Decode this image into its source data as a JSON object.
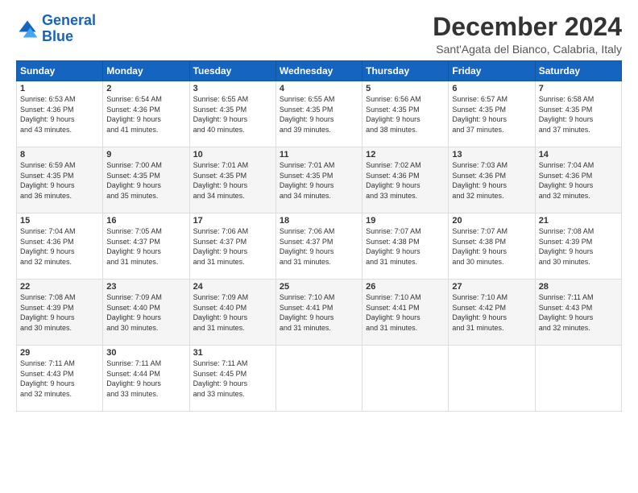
{
  "logo": {
    "line1": "General",
    "line2": "Blue"
  },
  "title": "December 2024",
  "subtitle": "Sant'Agata del Bianco, Calabria, Italy",
  "days": [
    "Sunday",
    "Monday",
    "Tuesday",
    "Wednesday",
    "Thursday",
    "Friday",
    "Saturday"
  ],
  "weeks": [
    [
      {
        "day": "1",
        "sunrise": "6:53 AM",
        "sunset": "4:36 PM",
        "daylight_hours": "9 hours",
        "daylight_min": "43 minutes."
      },
      {
        "day": "2",
        "sunrise": "6:54 AM",
        "sunset": "4:36 PM",
        "daylight_hours": "9 hours",
        "daylight_min": "41 minutes."
      },
      {
        "day": "3",
        "sunrise": "6:55 AM",
        "sunset": "4:35 PM",
        "daylight_hours": "9 hours",
        "daylight_min": "40 minutes."
      },
      {
        "day": "4",
        "sunrise": "6:55 AM",
        "sunset": "4:35 PM",
        "daylight_hours": "9 hours",
        "daylight_min": "39 minutes."
      },
      {
        "day": "5",
        "sunrise": "6:56 AM",
        "sunset": "4:35 PM",
        "daylight_hours": "9 hours",
        "daylight_min": "38 minutes."
      },
      {
        "day": "6",
        "sunrise": "6:57 AM",
        "sunset": "4:35 PM",
        "daylight_hours": "9 hours",
        "daylight_min": "37 minutes."
      },
      {
        "day": "7",
        "sunrise": "6:58 AM",
        "sunset": "4:35 PM",
        "daylight_hours": "9 hours",
        "daylight_min": "37 minutes."
      }
    ],
    [
      {
        "day": "8",
        "sunrise": "6:59 AM",
        "sunset": "4:35 PM",
        "daylight_hours": "9 hours",
        "daylight_min": "36 minutes."
      },
      {
        "day": "9",
        "sunrise": "7:00 AM",
        "sunset": "4:35 PM",
        "daylight_hours": "9 hours",
        "daylight_min": "35 minutes."
      },
      {
        "day": "10",
        "sunrise": "7:01 AM",
        "sunset": "4:35 PM",
        "daylight_hours": "9 hours",
        "daylight_min": "34 minutes."
      },
      {
        "day": "11",
        "sunrise": "7:01 AM",
        "sunset": "4:35 PM",
        "daylight_hours": "9 hours",
        "daylight_min": "34 minutes."
      },
      {
        "day": "12",
        "sunrise": "7:02 AM",
        "sunset": "4:36 PM",
        "daylight_hours": "9 hours",
        "daylight_min": "33 minutes."
      },
      {
        "day": "13",
        "sunrise": "7:03 AM",
        "sunset": "4:36 PM",
        "daylight_hours": "9 hours",
        "daylight_min": "32 minutes."
      },
      {
        "day": "14",
        "sunrise": "7:04 AM",
        "sunset": "4:36 PM",
        "daylight_hours": "9 hours",
        "daylight_min": "32 minutes."
      }
    ],
    [
      {
        "day": "15",
        "sunrise": "7:04 AM",
        "sunset": "4:36 PM",
        "daylight_hours": "9 hours",
        "daylight_min": "32 minutes."
      },
      {
        "day": "16",
        "sunrise": "7:05 AM",
        "sunset": "4:37 PM",
        "daylight_hours": "9 hours",
        "daylight_min": "31 minutes."
      },
      {
        "day": "17",
        "sunrise": "7:06 AM",
        "sunset": "4:37 PM",
        "daylight_hours": "9 hours",
        "daylight_min": "31 minutes."
      },
      {
        "day": "18",
        "sunrise": "7:06 AM",
        "sunset": "4:37 PM",
        "daylight_hours": "9 hours",
        "daylight_min": "31 minutes."
      },
      {
        "day": "19",
        "sunrise": "7:07 AM",
        "sunset": "4:38 PM",
        "daylight_hours": "9 hours",
        "daylight_min": "31 minutes."
      },
      {
        "day": "20",
        "sunrise": "7:07 AM",
        "sunset": "4:38 PM",
        "daylight_hours": "9 hours",
        "daylight_min": "30 minutes."
      },
      {
        "day": "21",
        "sunrise": "7:08 AM",
        "sunset": "4:39 PM",
        "daylight_hours": "9 hours",
        "daylight_min": "30 minutes."
      }
    ],
    [
      {
        "day": "22",
        "sunrise": "7:08 AM",
        "sunset": "4:39 PM",
        "daylight_hours": "9 hours",
        "daylight_min": "30 minutes."
      },
      {
        "day": "23",
        "sunrise": "7:09 AM",
        "sunset": "4:40 PM",
        "daylight_hours": "9 hours",
        "daylight_min": "30 minutes."
      },
      {
        "day": "24",
        "sunrise": "7:09 AM",
        "sunset": "4:40 PM",
        "daylight_hours": "9 hours",
        "daylight_min": "31 minutes."
      },
      {
        "day": "25",
        "sunrise": "7:10 AM",
        "sunset": "4:41 PM",
        "daylight_hours": "9 hours",
        "daylight_min": "31 minutes."
      },
      {
        "day": "26",
        "sunrise": "7:10 AM",
        "sunset": "4:41 PM",
        "daylight_hours": "9 hours",
        "daylight_min": "31 minutes."
      },
      {
        "day": "27",
        "sunrise": "7:10 AM",
        "sunset": "4:42 PM",
        "daylight_hours": "9 hours",
        "daylight_min": "31 minutes."
      },
      {
        "day": "28",
        "sunrise": "7:11 AM",
        "sunset": "4:43 PM",
        "daylight_hours": "9 hours",
        "daylight_min": "32 minutes."
      }
    ],
    [
      {
        "day": "29",
        "sunrise": "7:11 AM",
        "sunset": "4:43 PM",
        "daylight_hours": "9 hours",
        "daylight_min": "32 minutes."
      },
      {
        "day": "30",
        "sunrise": "7:11 AM",
        "sunset": "4:44 PM",
        "daylight_hours": "9 hours",
        "daylight_min": "33 minutes."
      },
      {
        "day": "31",
        "sunrise": "7:11 AM",
        "sunset": "4:45 PM",
        "daylight_hours": "9 hours",
        "daylight_min": "33 minutes."
      },
      null,
      null,
      null,
      null
    ]
  ],
  "labels": {
    "sunrise": "Sunrise:",
    "sunset": "Sunset:",
    "daylight": "Daylight:"
  }
}
